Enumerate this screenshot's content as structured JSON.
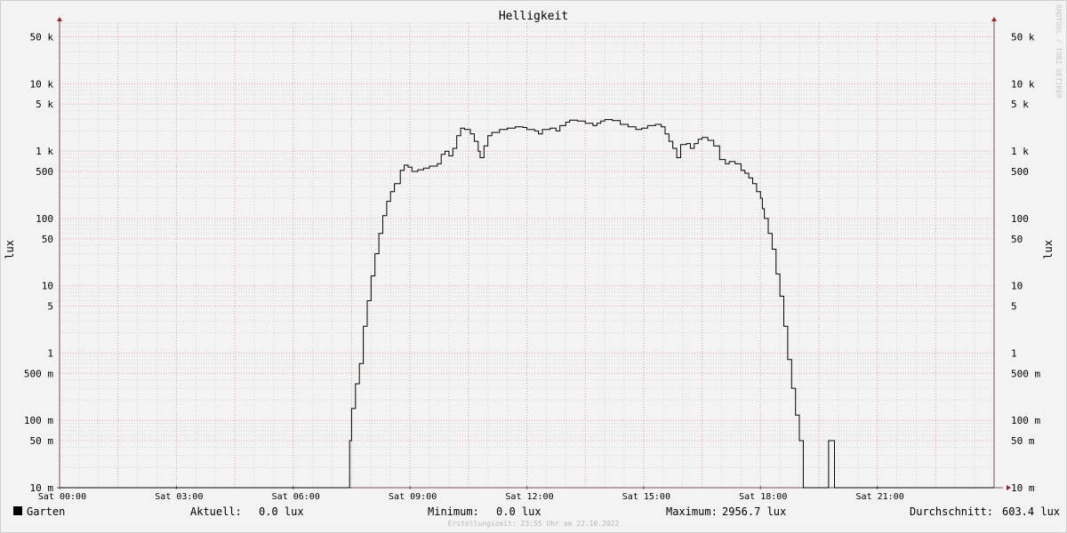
{
  "chart_data": {
    "type": "line",
    "title": "Helligkeit",
    "ylabel": "lux",
    "yscale": "log",
    "ylim": [
      0.01,
      80000
    ],
    "xlim": [
      0,
      24
    ],
    "grid": true,
    "y_ticks": [
      {
        "value": 0.01,
        "label": "10 m"
      },
      {
        "value": 0.05,
        "label": "50 m"
      },
      {
        "value": 0.1,
        "label": "100 m"
      },
      {
        "value": 0.5,
        "label": "500 m"
      },
      {
        "value": 1,
        "label": "1"
      },
      {
        "value": 5,
        "label": "5"
      },
      {
        "value": 10,
        "label": "10"
      },
      {
        "value": 50,
        "label": "50"
      },
      {
        "value": 100,
        "label": "100"
      },
      {
        "value": 500,
        "label": "500"
      },
      {
        "value": 1000,
        "label": "1 k"
      },
      {
        "value": 5000,
        "label": "5 k"
      },
      {
        "value": 10000,
        "label": "10 k"
      },
      {
        "value": 50000,
        "label": "50 k"
      }
    ],
    "x_ticks": [
      {
        "value": 0,
        "label": "Sat 00:00"
      },
      {
        "value": 3,
        "label": "Sat 03:00"
      },
      {
        "value": 6,
        "label": "Sat 06:00"
      },
      {
        "value": 9,
        "label": "Sat 09:00"
      },
      {
        "value": 12,
        "label": "Sat 12:00"
      },
      {
        "value": 15,
        "label": "Sat 15:00"
      },
      {
        "value": 18,
        "label": "Sat 18:00"
      },
      {
        "value": 21,
        "label": "Sat 21:00"
      }
    ],
    "series": [
      {
        "name": "Garten",
        "color": "#000000",
        "points": [
          [
            0,
            0.01
          ],
          [
            7.45,
            0.01
          ],
          [
            7.45,
            0.05
          ],
          [
            7.5,
            0.15
          ],
          [
            7.6,
            0.35
          ],
          [
            7.7,
            0.7
          ],
          [
            7.8,
            2.5
          ],
          [
            7.9,
            6
          ],
          [
            8.0,
            14
          ],
          [
            8.1,
            30
          ],
          [
            8.2,
            60
          ],
          [
            8.3,
            110
          ],
          [
            8.4,
            180
          ],
          [
            8.5,
            250
          ],
          [
            8.6,
            330
          ],
          [
            8.75,
            520
          ],
          [
            8.85,
            620
          ],
          [
            8.95,
            580
          ],
          [
            9.05,
            500
          ],
          [
            9.2,
            530
          ],
          [
            9.35,
            560
          ],
          [
            9.5,
            600
          ],
          [
            9.7,
            650
          ],
          [
            9.8,
            900
          ],
          [
            9.9,
            1000
          ],
          [
            10.0,
            850
          ],
          [
            10.1,
            1100
          ],
          [
            10.2,
            1700
          ],
          [
            10.3,
            2200
          ],
          [
            10.4,
            2100
          ],
          [
            10.55,
            1800
          ],
          [
            10.65,
            1400
          ],
          [
            10.75,
            1000
          ],
          [
            10.8,
            800
          ],
          [
            10.85,
            800
          ],
          [
            10.9,
            1200
          ],
          [
            11.0,
            1700
          ],
          [
            11.1,
            1900
          ],
          [
            11.3,
            2100
          ],
          [
            11.5,
            2200
          ],
          [
            11.7,
            2300
          ],
          [
            11.9,
            2250
          ],
          [
            12.0,
            2100
          ],
          [
            12.2,
            2000
          ],
          [
            12.3,
            1800
          ],
          [
            12.4,
            2100
          ],
          [
            12.6,
            2200
          ],
          [
            12.75,
            2000
          ],
          [
            12.85,
            2400
          ],
          [
            13.0,
            2700
          ],
          [
            13.1,
            2900
          ],
          [
            13.3,
            2800
          ],
          [
            13.5,
            2600
          ],
          [
            13.7,
            2400
          ],
          [
            13.8,
            2600
          ],
          [
            13.9,
            2800
          ],
          [
            14.0,
            2950
          ],
          [
            14.2,
            2850
          ],
          [
            14.4,
            2500
          ],
          [
            14.6,
            2300
          ],
          [
            14.8,
            2100
          ],
          [
            14.95,
            2200
          ],
          [
            15.1,
            2400
          ],
          [
            15.3,
            2500
          ],
          [
            15.45,
            2300
          ],
          [
            15.55,
            1800
          ],
          [
            15.65,
            1400
          ],
          [
            15.75,
            1100
          ],
          [
            15.85,
            800
          ],
          [
            15.95,
            1250
          ],
          [
            16.1,
            1300
          ],
          [
            16.2,
            1100
          ],
          [
            16.3,
            1300
          ],
          [
            16.4,
            1500
          ],
          [
            16.5,
            1600
          ],
          [
            16.65,
            1450
          ],
          [
            16.8,
            1200
          ],
          [
            16.95,
            750
          ],
          [
            17.1,
            650
          ],
          [
            17.2,
            700
          ],
          [
            17.35,
            650
          ],
          [
            17.5,
            520
          ],
          [
            17.6,
            470
          ],
          [
            17.7,
            400
          ],
          [
            17.8,
            330
          ],
          [
            17.9,
            250
          ],
          [
            18.0,
            200
          ],
          [
            18.05,
            140
          ],
          [
            18.1,
            100
          ],
          [
            18.2,
            60
          ],
          [
            18.3,
            35
          ],
          [
            18.4,
            15
          ],
          [
            18.5,
            7
          ],
          [
            18.6,
            2.5
          ],
          [
            18.7,
            0.8
          ],
          [
            18.8,
            0.3
          ],
          [
            18.9,
            0.12
          ],
          [
            19.0,
            0.05
          ],
          [
            19.1,
            0.01
          ],
          [
            19.75,
            0.01
          ],
          [
            19.75,
            0.05
          ],
          [
            19.9,
            0.05
          ],
          [
            19.9,
            0.01
          ],
          [
            24,
            0.01
          ]
        ]
      }
    ],
    "legend": {
      "name": "Garten",
      "current_label": "Aktuell:",
      "current_value": "0.0 lux",
      "min_label": "Minimum:",
      "min_value": "0.0 lux",
      "max_label": "Maximum:",
      "max_value": "2956.7 lux",
      "avg_label": "Durchschnitt:",
      "avg_value": "603.4 lux"
    }
  },
  "footer": "Erstellungszeit: 23:55 Uhr am 22.10.2022",
  "watermark": "RRDTOOL / TOBI OETIKER"
}
